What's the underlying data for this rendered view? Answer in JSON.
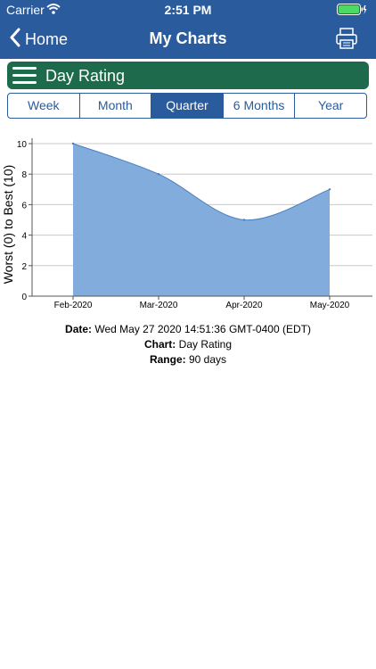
{
  "status_bar": {
    "carrier": "Carrier",
    "time": "2:51 PM"
  },
  "nav": {
    "back_label": "Home",
    "title": "My Charts"
  },
  "section": {
    "title": "Day Rating"
  },
  "tabs": [
    {
      "label": "Week",
      "active": false
    },
    {
      "label": "Month",
      "active": false
    },
    {
      "label": "Quarter",
      "active": true
    },
    {
      "label": "6 Months",
      "active": false
    },
    {
      "label": "Year",
      "active": false
    }
  ],
  "chart_data": {
    "type": "area",
    "categories": [
      "Feb-2020",
      "Mar-2020",
      "Apr-2020",
      "May-2020"
    ],
    "values": [
      10,
      8,
      5,
      7
    ],
    "ylabel": "Worst (0) to Best (10)",
    "xlabel": "",
    "ylim": [
      0,
      10
    ],
    "yticks": [
      "0",
      "2",
      "4",
      "6",
      "8",
      "10"
    ],
    "grid": true,
    "fill_color": "#82acdc",
    "line_color": "#4a7fc0"
  },
  "info": {
    "date_label": "Date:",
    "date_value": "Wed May 27 2020 14:51:36 GMT-0400 (EDT)",
    "chart_label": "Chart:",
    "chart_value": "Day Rating",
    "range_label": "Range:",
    "range_value": "90 days"
  },
  "colors": {
    "nav_bg": "#2a5b9c",
    "header_bg": "#1e6a4c",
    "accent": "#2a5b9c"
  }
}
